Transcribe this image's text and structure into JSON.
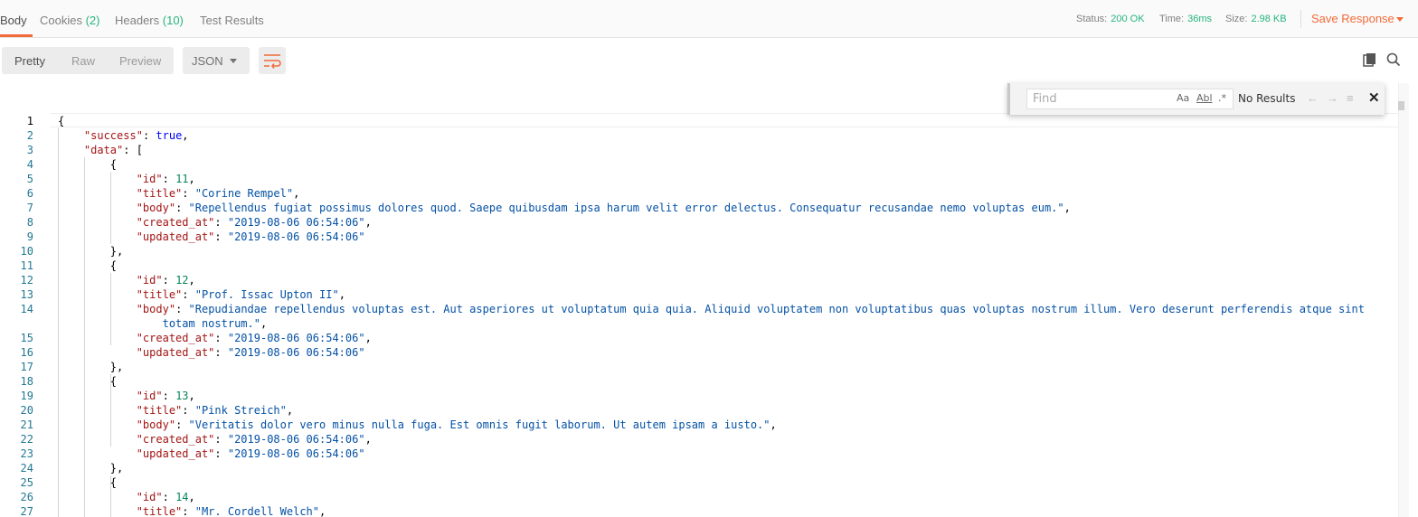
{
  "tabs": [
    {
      "label": "Body",
      "count": ""
    },
    {
      "label": "Cookies",
      "count": "(2)"
    },
    {
      "label": "Headers",
      "count": "(10)"
    },
    {
      "label": "Test Results",
      "count": ""
    }
  ],
  "status": {
    "status_label": "Status:",
    "status_value": "200 OK",
    "time_label": "Time:",
    "time_value": "36ms",
    "size_label": "Size:",
    "size_value": "2.98 KB"
  },
  "save_response_label": "Save Response",
  "view_modes": [
    "Pretty",
    "Raw",
    "Preview"
  ],
  "format_select": {
    "selected": "JSON"
  },
  "icons": {
    "wrap": "wrap-lines-icon",
    "copy": "copy-icon",
    "search": "search-icon"
  },
  "find": {
    "placeholder": "Find",
    "match_case": "Aa",
    "whole_word": "Abl",
    "regex": ".*",
    "results": "No Results",
    "prev": "←",
    "next": "→",
    "selection": "≡",
    "close": "✕"
  },
  "colors": {
    "accent": "#f26b3a",
    "ok": "#26b47f",
    "key": "#a31515",
    "string": "#0451a5",
    "number": "#098658",
    "bool": "#0000ff"
  },
  "code_lines": [
    {
      "n": "1",
      "t": [
        [
          "p",
          "{"
        ]
      ]
    },
    {
      "n": "2",
      "t": [
        [
          "p",
          "    "
        ],
        [
          "k",
          "\"success\""
        ],
        [
          "p",
          ": "
        ],
        [
          "b",
          "true"
        ],
        [
          "p",
          ","
        ]
      ]
    },
    {
      "n": "3",
      "t": [
        [
          "p",
          "    "
        ],
        [
          "k",
          "\"data\""
        ],
        [
          "p",
          ": ["
        ]
      ]
    },
    {
      "n": "4",
      "t": [
        [
          "p",
          "        {"
        ]
      ]
    },
    {
      "n": "5",
      "t": [
        [
          "p",
          "            "
        ],
        [
          "k",
          "\"id\""
        ],
        [
          "p",
          ": "
        ],
        [
          "n",
          "11"
        ],
        [
          "p",
          ","
        ]
      ]
    },
    {
      "n": "6",
      "t": [
        [
          "p",
          "            "
        ],
        [
          "k",
          "\"title\""
        ],
        [
          "p",
          ": "
        ],
        [
          "s",
          "\"Corine Rempel\""
        ],
        [
          "p",
          ","
        ]
      ]
    },
    {
      "n": "7",
      "t": [
        [
          "p",
          "            "
        ],
        [
          "k",
          "\"body\""
        ],
        [
          "p",
          ": "
        ],
        [
          "s",
          "\"Repellendus fugiat possimus dolores quod. Saepe quibusdam ipsa harum velit error delectus. Consequatur recusandae nemo voluptas eum.\""
        ],
        [
          "p",
          ","
        ]
      ]
    },
    {
      "n": "8",
      "t": [
        [
          "p",
          "            "
        ],
        [
          "k",
          "\"created_at\""
        ],
        [
          "p",
          ": "
        ],
        [
          "s",
          "\"2019-08-06 06:54:06\""
        ],
        [
          "p",
          ","
        ]
      ]
    },
    {
      "n": "9",
      "t": [
        [
          "p",
          "            "
        ],
        [
          "k",
          "\"updated_at\""
        ],
        [
          "p",
          ": "
        ],
        [
          "s",
          "\"2019-08-06 06:54:06\""
        ]
      ]
    },
    {
      "n": "10",
      "t": [
        [
          "p",
          "        },"
        ]
      ]
    },
    {
      "n": "11",
      "t": [
        [
          "p",
          "        {"
        ]
      ]
    },
    {
      "n": "12",
      "t": [
        [
          "p",
          "            "
        ],
        [
          "k",
          "\"id\""
        ],
        [
          "p",
          ": "
        ],
        [
          "n",
          "12"
        ],
        [
          "p",
          ","
        ]
      ]
    },
    {
      "n": "13",
      "t": [
        [
          "p",
          "            "
        ],
        [
          "k",
          "\"title\""
        ],
        [
          "p",
          ": "
        ],
        [
          "s",
          "\"Prof. Issac Upton II\""
        ],
        [
          "p",
          ","
        ]
      ]
    },
    {
      "n": "14",
      "t": [
        [
          "p",
          "            "
        ],
        [
          "k",
          "\"body\""
        ],
        [
          "p",
          ": "
        ],
        [
          "s",
          "\"Repudiandae repellendus voluptas est. Aut asperiores ut voluptatum quia quia. Aliquid voluptatem non voluptatibus quas voluptas nostrum illum. Vero deserunt perferendis atque sint"
        ]
      ]
    },
    {
      "n": "",
      "t": [
        [
          "p",
          "                "
        ],
        [
          "s",
          "totam nostrum.\""
        ],
        [
          "p",
          ","
        ]
      ]
    },
    {
      "n": "15",
      "t": [
        [
          "p",
          "            "
        ],
        [
          "k",
          "\"created_at\""
        ],
        [
          "p",
          ": "
        ],
        [
          "s",
          "\"2019-08-06 06:54:06\""
        ],
        [
          "p",
          ","
        ]
      ]
    },
    {
      "n": "16",
      "t": [
        [
          "p",
          "            "
        ],
        [
          "k",
          "\"updated_at\""
        ],
        [
          "p",
          ": "
        ],
        [
          "s",
          "\"2019-08-06 06:54:06\""
        ]
      ]
    },
    {
      "n": "17",
      "t": [
        [
          "p",
          "        },"
        ]
      ]
    },
    {
      "n": "18",
      "t": [
        [
          "p",
          "        {"
        ]
      ]
    },
    {
      "n": "19",
      "t": [
        [
          "p",
          "            "
        ],
        [
          "k",
          "\"id\""
        ],
        [
          "p",
          ": "
        ],
        [
          "n",
          "13"
        ],
        [
          "p",
          ","
        ]
      ]
    },
    {
      "n": "20",
      "t": [
        [
          "p",
          "            "
        ],
        [
          "k",
          "\"title\""
        ],
        [
          "p",
          ": "
        ],
        [
          "s",
          "\"Pink Streich\""
        ],
        [
          "p",
          ","
        ]
      ]
    },
    {
      "n": "21",
      "t": [
        [
          "p",
          "            "
        ],
        [
          "k",
          "\"body\""
        ],
        [
          "p",
          ": "
        ],
        [
          "s",
          "\"Veritatis dolor vero minus nulla fuga. Est omnis fugit laborum. Ut autem ipsam a iusto.\""
        ],
        [
          "p",
          ","
        ]
      ]
    },
    {
      "n": "22",
      "t": [
        [
          "p",
          "            "
        ],
        [
          "k",
          "\"created_at\""
        ],
        [
          "p",
          ": "
        ],
        [
          "s",
          "\"2019-08-06 06:54:06\""
        ],
        [
          "p",
          ","
        ]
      ]
    },
    {
      "n": "23",
      "t": [
        [
          "p",
          "            "
        ],
        [
          "k",
          "\"updated_at\""
        ],
        [
          "p",
          ": "
        ],
        [
          "s",
          "\"2019-08-06 06:54:06\""
        ]
      ]
    },
    {
      "n": "24",
      "t": [
        [
          "p",
          "        },"
        ]
      ]
    },
    {
      "n": "25",
      "t": [
        [
          "p",
          "        {"
        ]
      ]
    },
    {
      "n": "26",
      "t": [
        [
          "p",
          "            "
        ],
        [
          "k",
          "\"id\""
        ],
        [
          "p",
          ": "
        ],
        [
          "n",
          "14"
        ],
        [
          "p",
          ","
        ]
      ]
    },
    {
      "n": "27",
      "t": [
        [
          "p",
          "            "
        ],
        [
          "k",
          "\"title\""
        ],
        [
          "p",
          ": "
        ],
        [
          "s",
          "\"Mr. Cordell Welch\""
        ],
        [
          "p",
          ","
        ]
      ]
    }
  ]
}
